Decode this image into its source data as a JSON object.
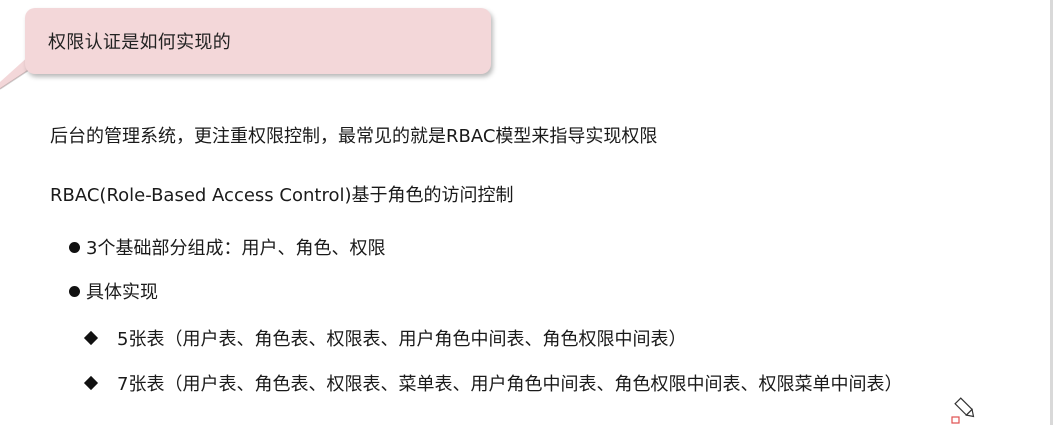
{
  "slide": {
    "title": "权限认证是如何实现的",
    "paragraphs": [
      "后台的管理系统，更注重权限控制，最常见的就是RBAC模型来指导实现权限",
      "RBAC(Role-Based Access Control)基于角色的访问控制"
    ],
    "bullets": [
      "3个基础部分组成：用户、角色、权限",
      "具体实现"
    ],
    "sub_bullets": [
      "5张表（用户表、角色表、权限表、用户角色中间表、角色权限中间表）",
      "7张表（用户表、角色表、权限表、菜单表、用户角色中间表、角色权限中间表、权限菜单中间表）"
    ]
  },
  "colors": {
    "bubble_fill": "#f3d7d9",
    "text": "#1a1a1a",
    "cursor_accent": "#e05050"
  },
  "icons": {
    "cursor": "pen-cursor-icon"
  }
}
